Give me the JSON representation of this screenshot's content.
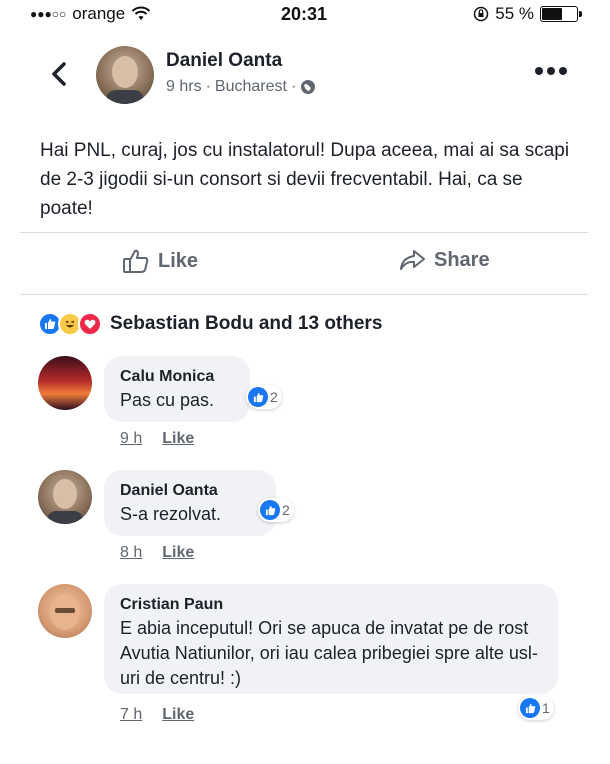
{
  "status_bar": {
    "carrier": "orange",
    "time": "20:31",
    "battery": "55 %"
  },
  "post": {
    "author": "Daniel Oanta",
    "time": "9 hrs",
    "separator": "·",
    "location": "Bucharest",
    "text": "Hai PNL, curaj, jos cu instalatorul! Dupa aceea, mai ai sa scapi de 2-3 jigodii si-un consort si devii frecventabil. Hai, ca se poate!",
    "like_label": "Like",
    "share_label": "Share",
    "reactions_text": "Sebastian Bodu and 13 others"
  },
  "comments": [
    {
      "author": "Calu Monica",
      "text": "Pas cu pas.",
      "time": "9 h",
      "like_label": "Like",
      "reaction_count": "2"
    },
    {
      "author": "Daniel Oanta",
      "text": "S-a rezolvat.",
      "time": "8 h",
      "like_label": "Like",
      "reaction_count": "2"
    },
    {
      "author": "Cristian Paun",
      "text": "E abia inceputul! Ori se apuca de invatat pe de rost Avutia Natiunilor, ori iau calea pribegiei spre alte usl-uri de centru! :)",
      "time": "7 h",
      "like_label": "Like",
      "reaction_count": "1"
    }
  ],
  "colors": {
    "facebook_blue": "#1877f2",
    "haha_yellow": "#f7c948",
    "love_red": "#f0284a",
    "bubble_gray": "#f0f2f5"
  }
}
